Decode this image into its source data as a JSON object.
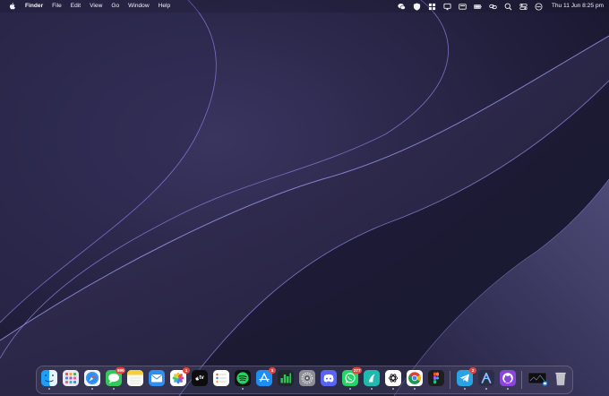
{
  "menubar": {
    "app_name": "Finder",
    "menus": [
      "File",
      "Edit",
      "View",
      "Go",
      "Window",
      "Help"
    ],
    "status_icons": [
      "wechat-icon",
      "shield-icon",
      "grid-icon",
      "broadcast-icon",
      "display-icon",
      "battery-icon",
      "link-icon",
      "search-icon",
      "control-center-icon",
      "siri-icon"
    ],
    "clock": "Thu 11 Jun  8:25 pm"
  },
  "dock": {
    "apps": [
      {
        "name": "finder",
        "running": true
      },
      {
        "name": "launchpad",
        "running": false
      },
      {
        "name": "safari",
        "running": true
      },
      {
        "name": "messages",
        "badge": "999",
        "running": true
      },
      {
        "name": "notes",
        "running": false
      },
      {
        "name": "mail",
        "running": false
      },
      {
        "name": "photos",
        "badge": "1",
        "running": false
      },
      {
        "name": "apple-tv",
        "label": "tv",
        "running": false
      },
      {
        "name": "reminders",
        "running": false
      },
      {
        "name": "spotify",
        "running": true
      },
      {
        "name": "app-store",
        "badge": "5",
        "running": false
      },
      {
        "name": "numbers",
        "running": false
      },
      {
        "name": "system-settings",
        "running": false
      },
      {
        "name": "discord",
        "running": false
      },
      {
        "name": "whatsapp",
        "badge": "277",
        "running": true
      },
      {
        "name": "surfshark",
        "running": true
      },
      {
        "name": "chatgpt",
        "running": true
      },
      {
        "name": "chrome",
        "running": true
      },
      {
        "name": "figma",
        "running": false
      },
      {
        "name": "telegram",
        "badge": "2",
        "running": true
      },
      {
        "name": "arc-linear",
        "running": true
      },
      {
        "name": "github-desktop",
        "running": true
      },
      {
        "name": "minimized-window",
        "running": false
      },
      {
        "name": "trash",
        "running": false
      }
    ]
  },
  "colors": {
    "badge": "#e8453c",
    "menubar_text": "#f2f2f6",
    "wallpaper_base": "#1a1830",
    "wallpaper_accent": "#8a87e0"
  }
}
